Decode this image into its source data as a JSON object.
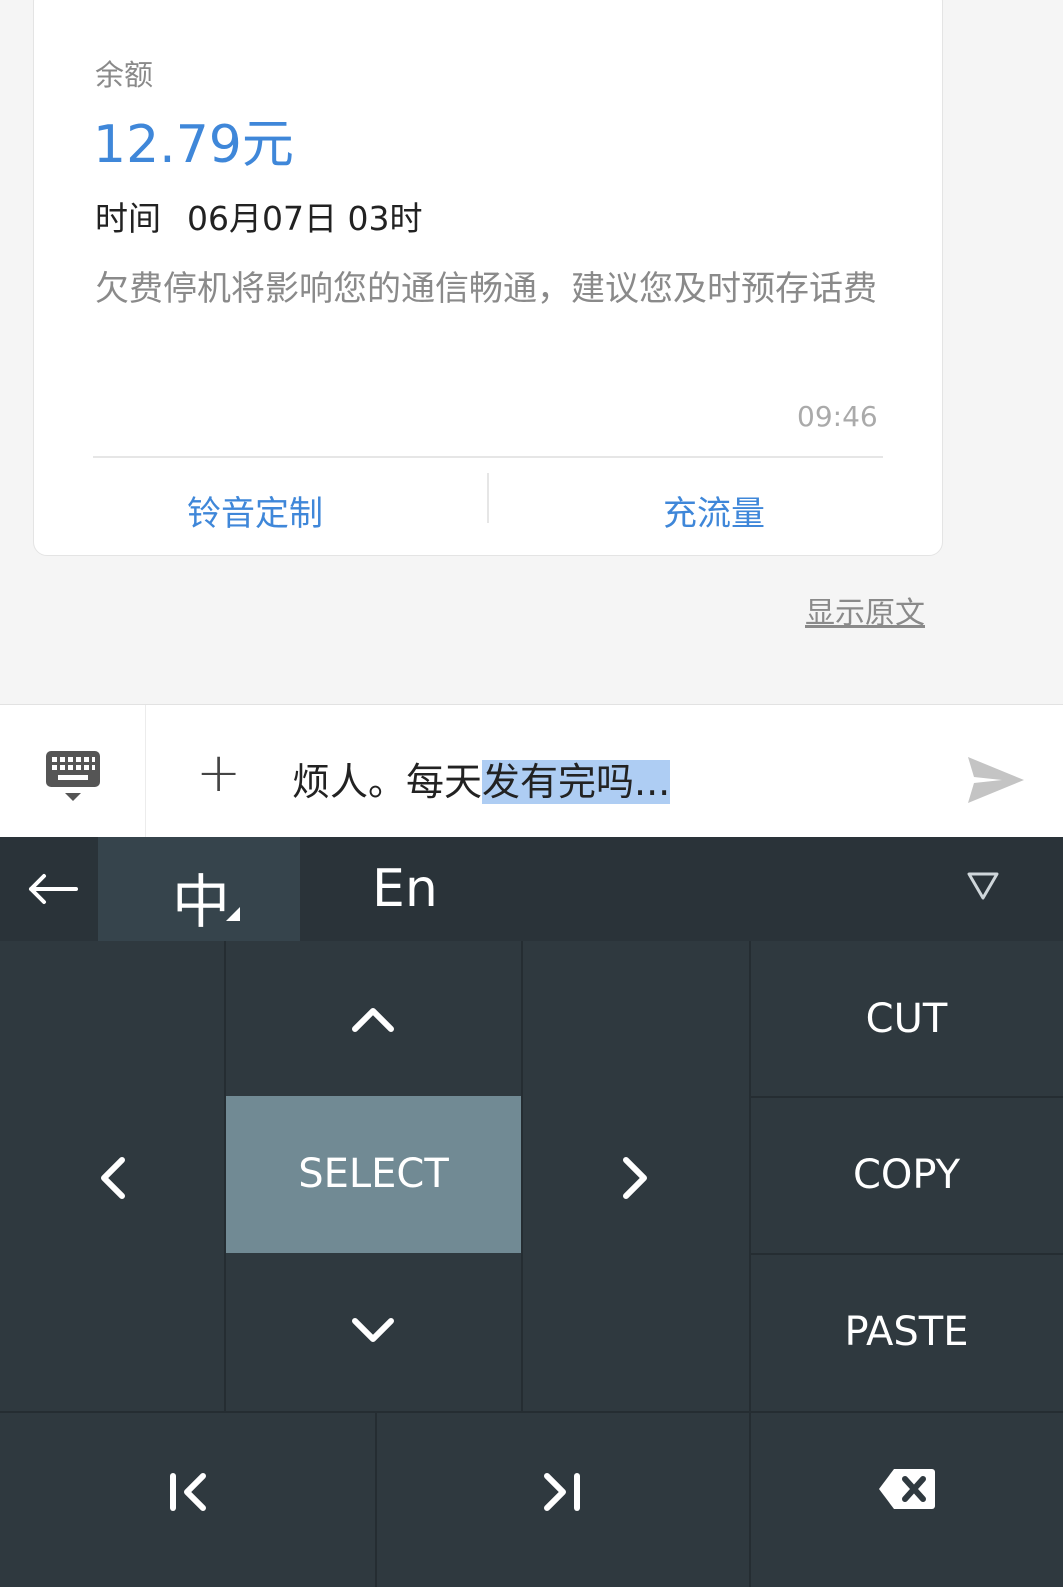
{
  "card": {
    "balance_label": "余额",
    "balance_value": "12.79元",
    "time_label": "时间",
    "time_value": "06月07日 03时",
    "notice": "欠费停机将影响您的通信畅通，建议您及时预存话费",
    "timestamp": "09:46",
    "actions": [
      "铃音定制",
      "充流量"
    ]
  },
  "show_original": "显示原文",
  "input": {
    "text_plain": "烦人。每天",
    "text_selected": "发有完吗...",
    "plus_label": "+"
  },
  "keyboard": {
    "tabs": {
      "zh": "中",
      "en": "En"
    },
    "edit": {
      "select": "SELECT",
      "cut": "CUT",
      "copy": "COPY",
      "paste": "PASTE"
    }
  },
  "colors": {
    "accent": "#3f87d9",
    "selection": "#aecdf3",
    "keyboard_bg": "#2a3339",
    "key_bg": "#2f393f",
    "select_key_bg": "#718a94"
  },
  "icons": [
    "keyboard-icon",
    "send-icon",
    "back-arrow-icon",
    "collapse-triangle-icon",
    "chevron-up-icon",
    "chevron-left-icon",
    "chevron-right-icon",
    "chevron-down-icon",
    "line-start-icon",
    "line-end-icon",
    "backspace-icon"
  ]
}
